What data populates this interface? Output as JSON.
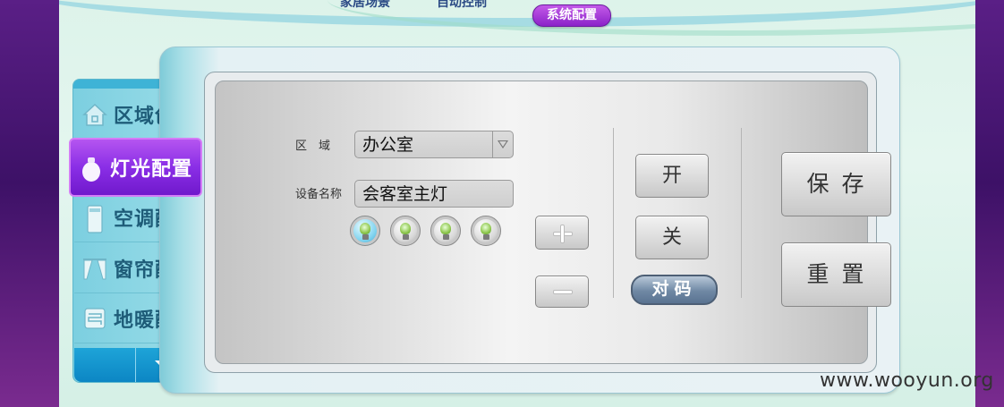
{
  "top_nav": {
    "items": [
      {
        "label": "家居场景"
      },
      {
        "label": "自动控制"
      },
      {
        "label": "系统配置"
      }
    ],
    "active_index": 2,
    "active_color": "#9b2fd6"
  },
  "sidebar": {
    "items": [
      {
        "label": "区域创建",
        "icon": "house-icon"
      },
      {
        "label": "灯光配置",
        "icon": "bulb-icon"
      },
      {
        "label": "空调配置",
        "icon": "air-conditioner-icon"
      },
      {
        "label": "窗帘配置",
        "icon": "curtain-icon"
      },
      {
        "label": "地暖配置",
        "icon": "floor-heating-icon"
      }
    ],
    "active_index": 1,
    "scroll_icon": "chevron-down-icon"
  },
  "form": {
    "area_label": "区　域",
    "area_value": "办公室",
    "device_label": "设备名称",
    "device_value": "会客室主灯",
    "bulb_icons": [
      "bulb-icon-selected",
      "bulb-icon",
      "bulb-icon",
      "bulb-icon"
    ],
    "selected_bulb": 0
  },
  "controls": {
    "plus_icon": "plus-icon",
    "minus_icon": "minus-icon",
    "on_label": "开",
    "off_label": "关",
    "pair_label": "对码",
    "save_label": "保存",
    "reset_label": "重置"
  },
  "watermark": "www.wooyun.org",
  "colors": {
    "accent_purple": "#8a2ee6",
    "sidebar_teal": "#7ccfe0",
    "pair_button": "#6f88a4"
  }
}
